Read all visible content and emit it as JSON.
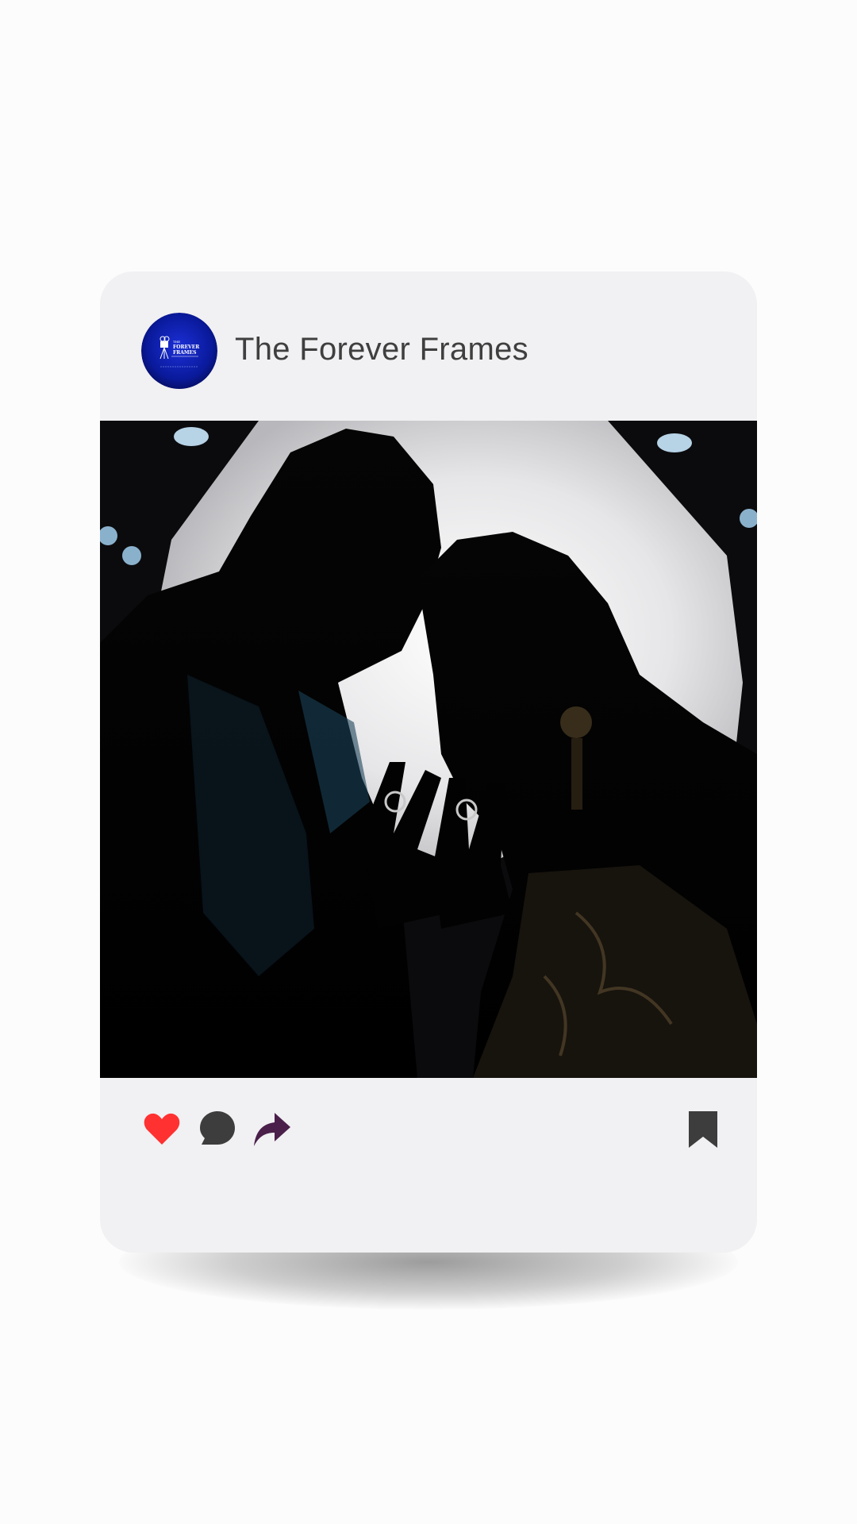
{
  "post": {
    "username": "The Forever Frames",
    "avatar": {
      "icon": "camera-logo-icon",
      "logo_text_line1": "THE",
      "logo_text_line2": "FOREVER",
      "logo_text_line3": "FRAMES",
      "brand_color": "#0a1a9c"
    },
    "photo": {
      "subject": "silhouette of couple touching foreheads showing rings"
    }
  },
  "actions": {
    "like_icon": "heart-icon",
    "like_color": "#ff3131",
    "comment_icon": "comment-bubble-icon",
    "comment_color": "#3d3d3d",
    "share_icon": "share-arrow-icon",
    "share_color": "#4a1f4a",
    "save_icon": "bookmark-icon",
    "save_color": "#3d3d3d"
  },
  "colors": {
    "card_background": "#f1f0f2",
    "page_background": "#fcfcfc",
    "username_text": "#3f3f3f"
  }
}
